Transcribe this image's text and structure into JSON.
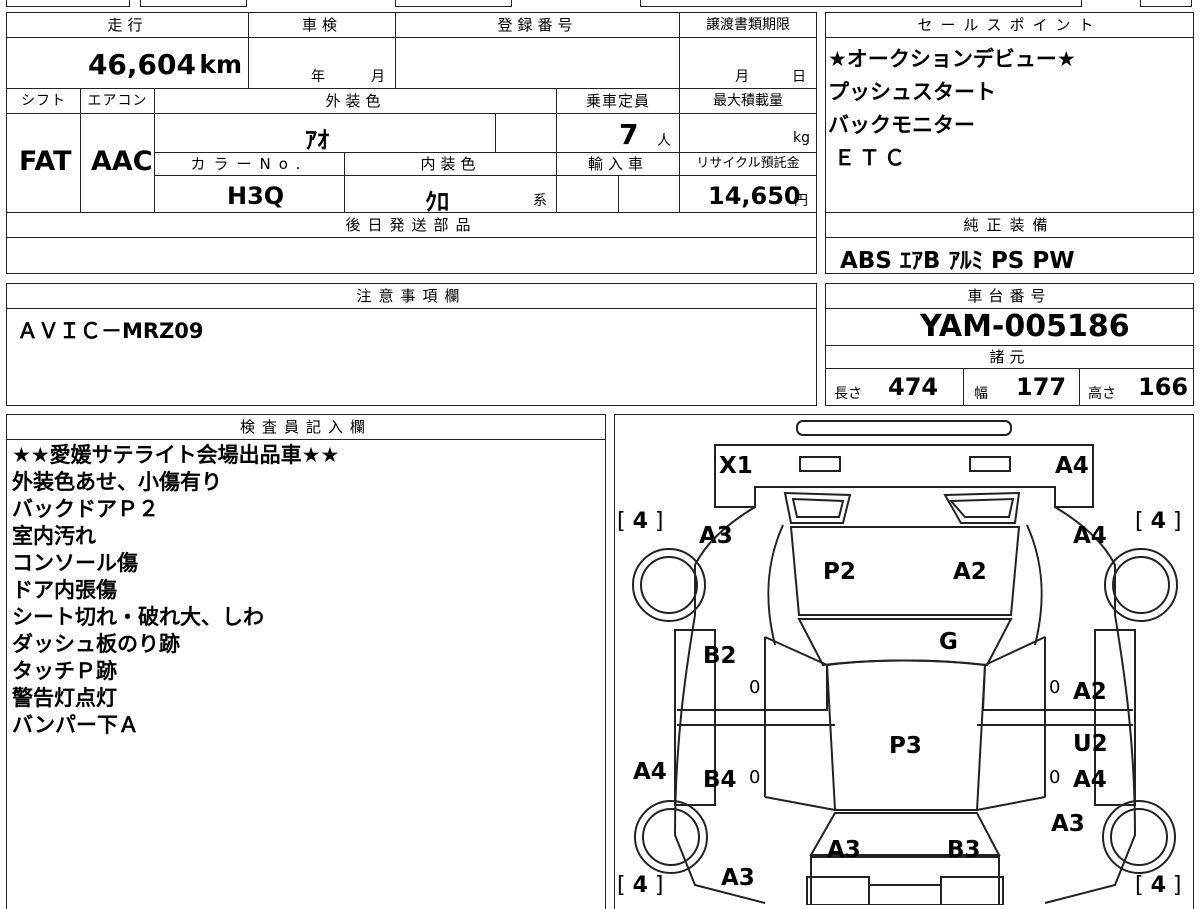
{
  "top": {
    "mileage_hdr": "走行",
    "shaken_hdr": "車検",
    "reg_hdr": "登録番号",
    "transfer_hdr": "譲渡書類期限",
    "mileage": "46,604",
    "mileage_unit": "km",
    "year_lbl": "年",
    "month_lbl": "月",
    "t_month_lbl": "月",
    "t_day_lbl": "日"
  },
  "row2": {
    "shift_hdr": "シフト",
    "ac_hdr": "エアコン",
    "exterior_hdr": "外装色",
    "capacity_hdr": "乗車定員",
    "maxload_hdr": "最大積載量",
    "shift": "FAT",
    "ac": "AAC",
    "exterior": "ｱｵ",
    "capacity": "7",
    "capacity_unit": "人",
    "maxload_unit": "kg",
    "color_no_hdr": "カラーNo.",
    "interior_hdr": "内装色",
    "import_hdr": "輸入車",
    "recycle_hdr": "リサイクル預託金",
    "color_no": "H3Q",
    "interior": "ｸﾛ",
    "interior_suffix": "系",
    "recycle": "14,650",
    "recycle_unit": "円"
  },
  "later_parts_hdr": "後日発送部品",
  "sales_points": {
    "hdr": "セールスポイント",
    "lines": [
      "★オークションデビュー★",
      "プッシュスタート",
      "バックモニター",
      "ＥＴＣ"
    ]
  },
  "equipment": {
    "hdr": "純正装備",
    "value": "ABS ｴｱB ｱﾙﾐ PS PW"
  },
  "caution": {
    "hdr": "注意事項欄",
    "value": "ＡＶＩＣ－MRZ09"
  },
  "chassis": {
    "hdr": "車台番号",
    "value": "YAM-005186"
  },
  "specs": {
    "hdr": "諸元",
    "length_lbl": "長さ",
    "length": "474",
    "width_lbl": "幅",
    "width": "177",
    "height_lbl": "高さ",
    "height": "166"
  },
  "inspector": {
    "hdr": "検査員記入欄",
    "lines": [
      "★★愛媛サテライト会場出品車★★",
      "外装色あせ、小傷有り",
      "バックドアＰ２",
      "室内汚れ",
      "コンソール傷",
      "ドア内張傷",
      "シート切れ・破れ大、しわ",
      "ダッシュ板のり跡",
      "タッチＰ跡",
      "警告灯点灯",
      "バンパー下Ａ"
    ]
  },
  "diagram": {
    "marks": {
      "front_left": "X1",
      "front_right": "A4",
      "fender_left": "A3",
      "fender_right": "A4",
      "hood_left": "P2",
      "hood_right": "A2",
      "windshield": "G",
      "front_door_left": "B2",
      "front_door_right": "A2",
      "roof": "P3",
      "rear_door_right_top": "U2",
      "rear_door_right": "A4",
      "rear_door_left": "B4",
      "sill_left": "A4",
      "quarter_right": "A3",
      "rear_left": "A3",
      "rear_right": "B3",
      "rear_fender_left": "A3"
    },
    "tire_front_left": "4",
    "tire_front_right": "4",
    "tire_rear_left": "4",
    "tire_rear_right": "4",
    "zero_a": "0",
    "zero_b": "0",
    "zero_c": "0",
    "zero_d": "0"
  }
}
